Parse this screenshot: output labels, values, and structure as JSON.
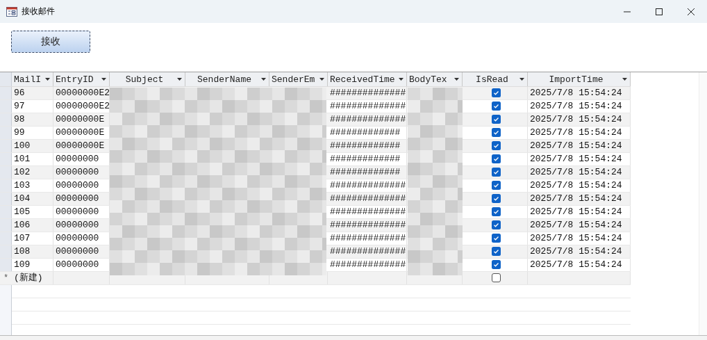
{
  "window": {
    "title": "接收邮件"
  },
  "form": {
    "receive_button": "接收"
  },
  "table": {
    "columns": [
      {
        "label": "MailI",
        "kind": "text"
      },
      {
        "label": "EntryID",
        "kind": "text"
      },
      {
        "label": "Subject",
        "kind": "hidden"
      },
      {
        "label": "SenderName",
        "kind": "hidden"
      },
      {
        "label": "SenderEm",
        "kind": "hidden"
      },
      {
        "label": "ReceivedTime",
        "kind": "text"
      },
      {
        "label": "BodyTex",
        "kind": "hidden"
      },
      {
        "label": "IsRead",
        "kind": "check"
      },
      {
        "label": "ImportTime",
        "kind": "text"
      }
    ],
    "rows": [
      {
        "mail_id": "96",
        "entry_id": "00000000E2",
        "received_time": "##############",
        "is_read": true,
        "import_time": "2025/7/8 15:54:24"
      },
      {
        "mail_id": "97",
        "entry_id": "00000000E2",
        "received_time": "##############",
        "is_read": true,
        "import_time": "2025/7/8 15:54:24"
      },
      {
        "mail_id": "98",
        "entry_id": "00000000E",
        "received_time": "##############",
        "is_read": true,
        "import_time": "2025/7/8 15:54:24"
      },
      {
        "mail_id": "99",
        "entry_id": "00000000E",
        "received_time": "#############",
        "is_read": true,
        "import_time": "2025/7/8 15:54:24"
      },
      {
        "mail_id": "100",
        "entry_id": "00000000E",
        "received_time": "#############",
        "is_read": true,
        "import_time": "2025/7/8 15:54:24"
      },
      {
        "mail_id": "101",
        "entry_id": "00000000",
        "received_time": "#############",
        "is_read": true,
        "import_time": "2025/7/8 15:54:24"
      },
      {
        "mail_id": "102",
        "entry_id": "00000000",
        "received_time": "#############",
        "is_read": true,
        "import_time": "2025/7/8 15:54:24"
      },
      {
        "mail_id": "103",
        "entry_id": "00000000",
        "received_time": "##############",
        "is_read": true,
        "import_time": "2025/7/8 15:54:24"
      },
      {
        "mail_id": "104",
        "entry_id": "00000000",
        "received_time": "##############",
        "is_read": true,
        "import_time": "2025/7/8 15:54:24"
      },
      {
        "mail_id": "105",
        "entry_id": "00000000",
        "received_time": "##############",
        "is_read": true,
        "import_time": "2025/7/8 15:54:24"
      },
      {
        "mail_id": "106",
        "entry_id": "00000000",
        "received_time": "##############",
        "is_read": true,
        "import_time": "2025/7/8 15:54:24"
      },
      {
        "mail_id": "107",
        "entry_id": "00000000",
        "received_time": "##############",
        "is_read": true,
        "import_time": "2025/7/8 15:54:24"
      },
      {
        "mail_id": "108",
        "entry_id": "00000000",
        "received_time": "##############",
        "is_read": true,
        "import_time": "2025/7/8 15:54:24"
      },
      {
        "mail_id": "109",
        "entry_id": "00000000",
        "received_time": "##############",
        "is_read": true,
        "import_time": "2025/7/8 15:54:24"
      }
    ],
    "new_row": {
      "marker": "*",
      "label": "(新建)",
      "is_read": false
    }
  }
}
